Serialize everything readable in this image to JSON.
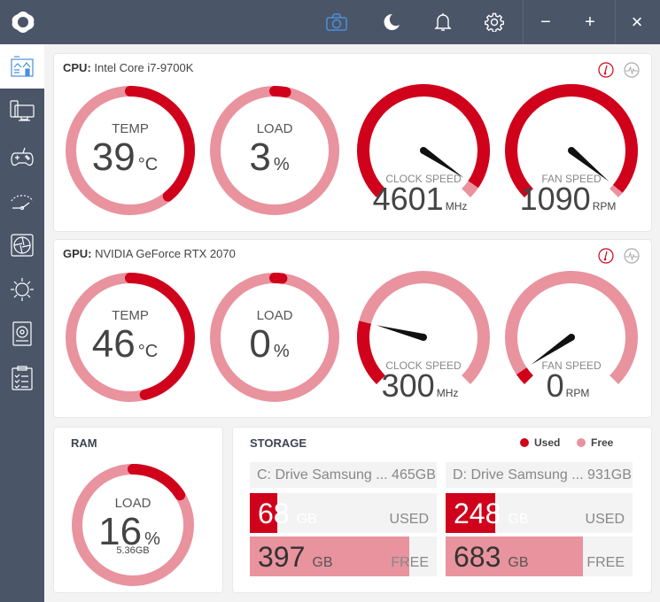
{
  "colors": {
    "accent": "#d0021b",
    "light": "#e8939e",
    "titlebar": "#4a5568",
    "camera": "#4a90d9"
  },
  "titlebar": {
    "icons": [
      "logo-icon",
      "camera-icon",
      "moon-icon",
      "bell-icon",
      "gear-icon"
    ],
    "minimize": "−",
    "maximize": "+",
    "close": "×"
  },
  "sidebar": {
    "items": [
      "dashboard",
      "pc",
      "gaming",
      "performance",
      "fan",
      "brightness",
      "storage",
      "report"
    ],
    "active": 0
  },
  "cpu": {
    "label": "CPU:",
    "name": "Intel Core i7-9700K",
    "temp": {
      "label": "TEMP",
      "value": "39",
      "unit": "°C",
      "level": 0.39
    },
    "load": {
      "label": "LOAD",
      "value": "3",
      "unit": "%",
      "level": 0.03
    },
    "clock": {
      "label": "CLOCK SPEED",
      "value": "4601",
      "unit": "MHz",
      "level": 0.96
    },
    "fan": {
      "label": "FAN SPEED",
      "value": "1090",
      "unit": "RPM",
      "level": 0.98
    }
  },
  "gpu": {
    "label": "GPU:",
    "name": "NVIDIA GeForce RTX 2070",
    "temp": {
      "label": "TEMP",
      "value": "46",
      "unit": "°C",
      "level": 0.46
    },
    "load": {
      "label": "LOAD",
      "value": "0",
      "unit": "%",
      "level": 0.0
    },
    "clock": {
      "label": "CLOCK SPEED",
      "value": "300",
      "unit": "MHz",
      "level": 0.22
    },
    "fan": {
      "label": "FAN SPEED",
      "value": "0",
      "unit": "RPM",
      "level": 0.04
    }
  },
  "ram": {
    "title": "RAM",
    "label": "LOAD",
    "value": "16",
    "unit": "%",
    "sub": "5.36GB",
    "level": 0.16
  },
  "storage": {
    "title": "STORAGE",
    "legend_used": "Used",
    "legend_free": "Free",
    "drives": [
      {
        "name": "C: Drive Samsung ... 465GB",
        "used": "68",
        "free": "397",
        "unit": "GB",
        "used_label": "USED",
        "free_label": "FREE",
        "used_frac": 0.146,
        "free_frac": 0.854
      },
      {
        "name": "D: Drive Samsung ... 931GB",
        "used": "248",
        "free": "683",
        "unit": "GB",
        "used_label": "USED",
        "free_label": "FREE",
        "used_frac": 0.266,
        "free_frac": 0.734
      }
    ]
  }
}
